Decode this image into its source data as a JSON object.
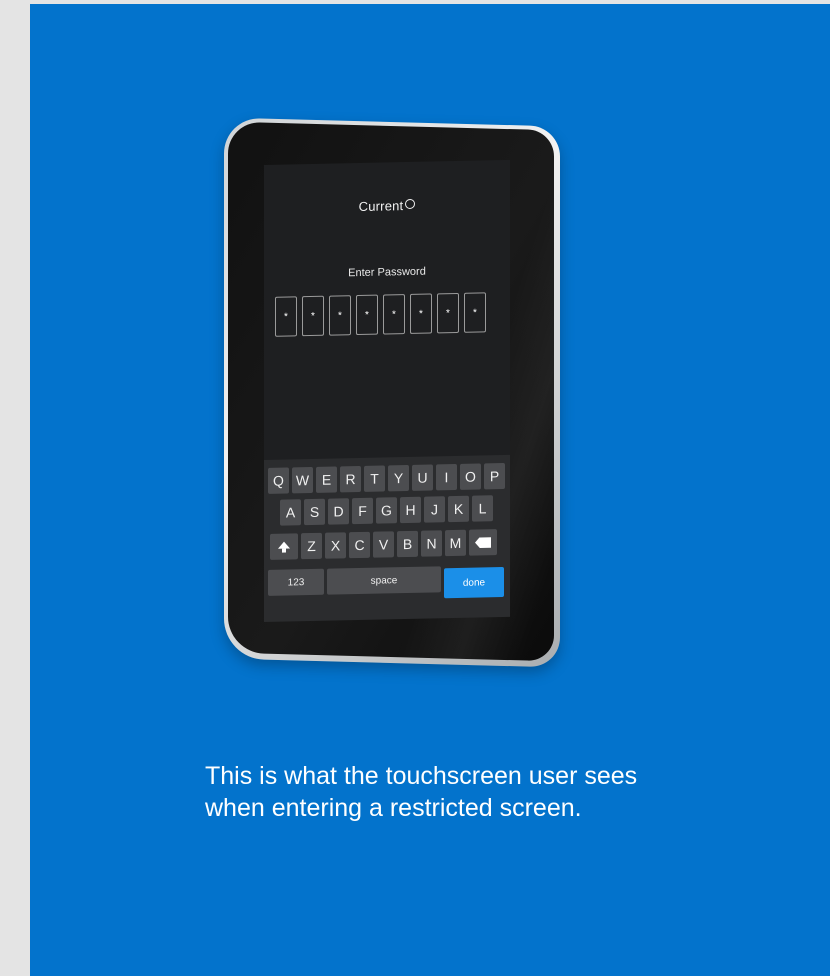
{
  "screen": {
    "brand": "Current",
    "prompt": "Enter Password",
    "password_chars": [
      "*",
      "*",
      "*",
      "*",
      "*",
      "*",
      "*",
      "*"
    ]
  },
  "keyboard": {
    "row1": [
      "Q",
      "W",
      "E",
      "R",
      "T",
      "Y",
      "U",
      "I",
      "O",
      "P"
    ],
    "row2": [
      "A",
      "S",
      "D",
      "F",
      "G",
      "H",
      "J",
      "K",
      "L"
    ],
    "row3": [
      "Z",
      "X",
      "C",
      "V",
      "B",
      "N",
      "M"
    ],
    "numbers_label": "123",
    "space_label": "space",
    "done_label": "done",
    "shift_icon": "shift-arrow-icon",
    "backspace_icon": "backspace-icon"
  },
  "caption": "This is what the touchscreen user sees when entering a restricted screen.",
  "colors": {
    "panel_bg": "#0373cc",
    "page_bg": "#e4e4e4",
    "done_key": "#1b8fe8"
  }
}
